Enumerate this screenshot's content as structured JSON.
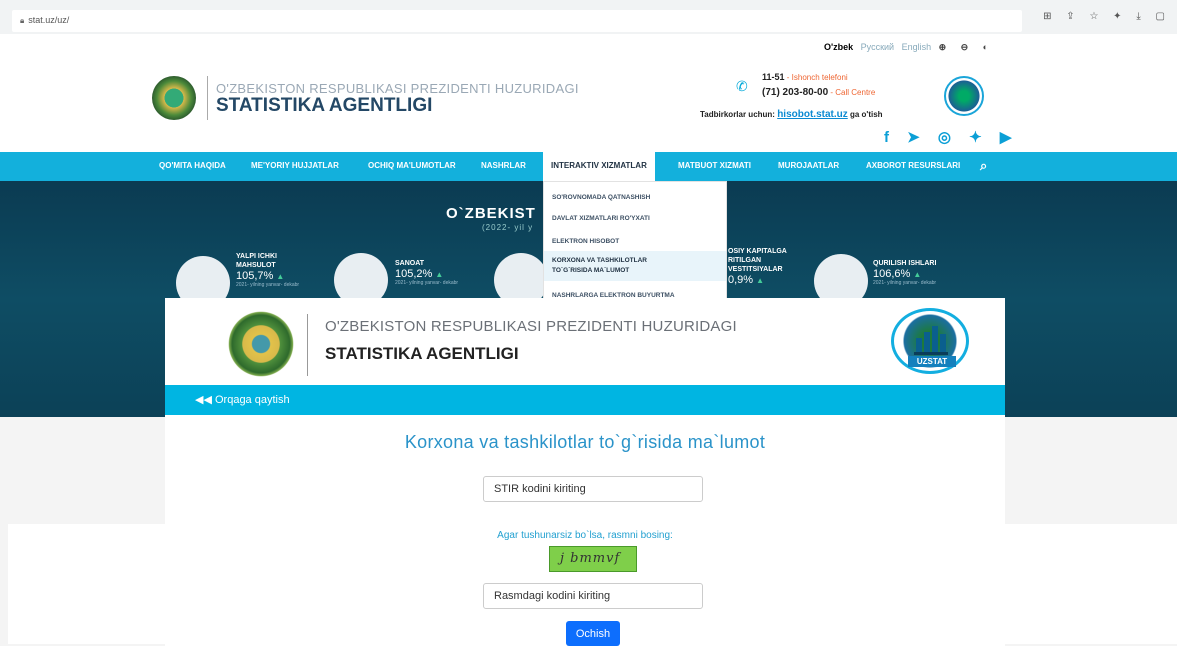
{
  "browser": {
    "url": "stat.uz/uz/",
    "toolbar_icons": "⊞ ⇪ ☆ ✦ ⤓ ▢"
  },
  "site": {
    "lang": {
      "uz": "O'zbek",
      "ru": "Русский",
      "en": "English",
      "tools": "⊕ ⊖ ◐"
    },
    "title_line1": "O'ZBEKISTON RESPUBLIKASI PREZIDENTI HUZURIDAGI",
    "title_line2": "STATISTIKA AGENTLIGI",
    "phone1_num": "11-51",
    "phone1_label": " - Ishonch telefoni",
    "phone2_num": "(71) 203-80-00",
    "phone2_label": " - Call Centre",
    "biz_prefix": "Tadbirkorlar uchun: ",
    "biz_link": "hisobot.stat.uz",
    "biz_suffix": " ga o'tish",
    "social": "f ➤ ◎ ✦ ▶",
    "nav": [
      "QO'MITA HAQIDA",
      "ME'YORIY HUJJATLAR",
      "OCHIQ MA'LUMOTLAR",
      "NASHRLAR",
      "INTERAKTIV XIZMATLAR",
      "MATBUOT XIZMATI",
      "MUROJAATLAR",
      "AXBOROT RESURSLARI"
    ],
    "dropdown": [
      "SO'ROVNOMADA QATNASHISH",
      "DAVLAT XIZMATLARI RO'YXATI",
      "ELEKTRON HISOBOT",
      "KORXONA VA TASHKILOTLAR",
      "TO`G`RISIDA MA`LUMOT",
      "NASHRLARGA ELEKTRON BUYURTMA"
    ],
    "banner_title": "O`ZBEKIST",
    "banner_sub": "(2022- yil y",
    "stats": [
      {
        "name1": "YALPI ICHKI",
        "name2": "MAHSULOT",
        "value": "105,7%",
        "note": "2021- yilning yanvar- dekabr"
      },
      {
        "name1": "SANOAT",
        "name2": "",
        "value": "105,2%",
        "note": "2021- yilning yanvar- dekabr"
      },
      {
        "name1": "OSIY KAPITALGA",
        "name2": "RITILGAN",
        "name3": "VESTITSIYALAR",
        "value": "0,9%",
        "note": ""
      },
      {
        "name1": "QURILISH ISHLARI",
        "name2": "",
        "value": "106,6%",
        "note": "2021- yilning yanvar- dekabr"
      }
    ]
  },
  "modal": {
    "title_line1": "O'ZBEKISTON RESPUBLIKASI PREZIDENTI HUZURIDAGI",
    "title_line2": "STATISTIKA AGENTLIGI",
    "logo_tag": "UZSTAT",
    "back_label": "Orqaga qaytish",
    "heading": "Korxona va tashkilotlar to`g`risida ma`lumot",
    "stir_placeholder": "STIR kodini kiriting",
    "hint": "Agar tushunarsiz bo`lsa, rasmni bosing:",
    "captcha_text": "j bmmvf",
    "code_placeholder": "Rasmdagi kodini kiriting",
    "submit_label": "Ochish"
  },
  "colors": {
    "accent": "#13b0dc",
    "button": "#0d6efd",
    "heading": "#2a93c9"
  }
}
